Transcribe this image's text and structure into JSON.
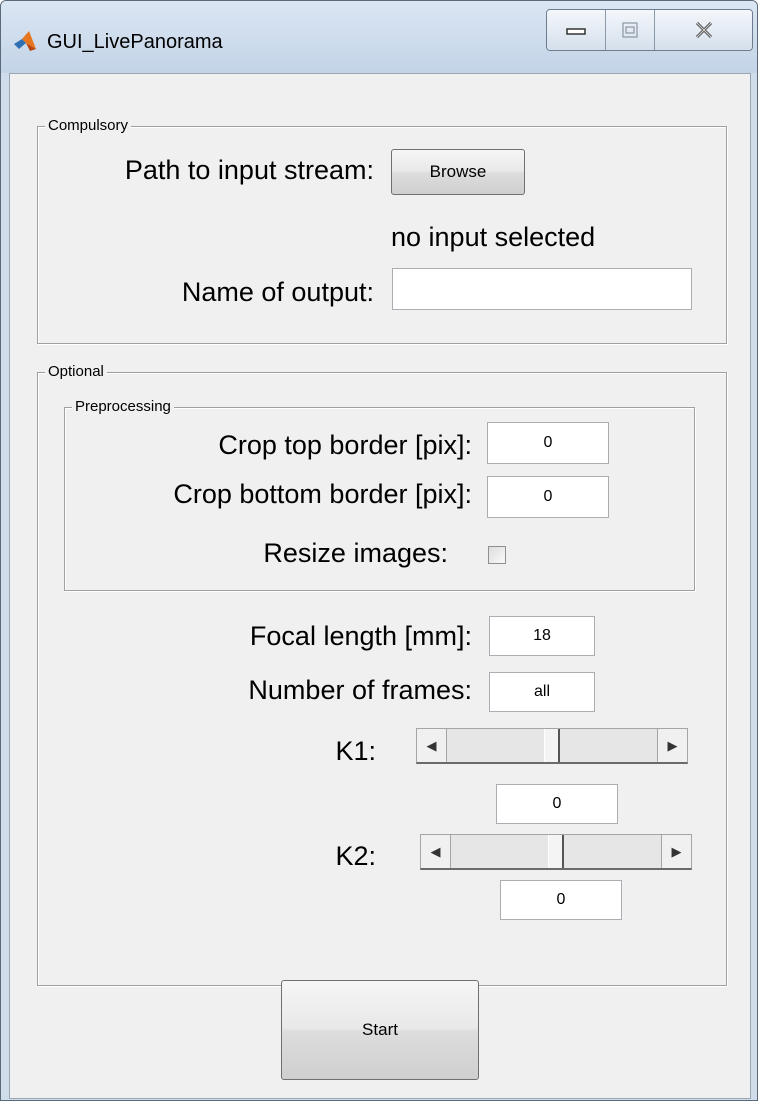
{
  "window": {
    "title": "GUI_LivePanorama",
    "icons": {
      "app": "matlab-logo-icon",
      "minimize": "minimize-icon",
      "maximize": "maximize-icon",
      "close": "close-icon"
    }
  },
  "compulsory": {
    "title": "Compulsory",
    "path_label": "Path to input stream:",
    "browse_label": "Browse",
    "input_status": "no input selected",
    "output_label": "Name of output:",
    "output_value": ""
  },
  "optional": {
    "title": "Optional",
    "preprocessing": {
      "title": "Preprocessing",
      "crop_top_label": "Crop top border [pix]:",
      "crop_top_value": "0",
      "crop_bottom_label": "Crop bottom border [pix]:",
      "crop_bottom_value": "0",
      "resize_label": "Resize images:",
      "resize_checked": false
    },
    "focal_label": "Focal length [mm]:",
    "focal_value": "18",
    "frames_label": "Number of frames:",
    "frames_value": "all",
    "k1": {
      "label": "K1:",
      "value": "0",
      "slider_fraction": 0.5
    },
    "k2": {
      "label": "K2:",
      "value": "0",
      "slider_fraction": 0.5
    }
  },
  "start_label": "Start"
}
